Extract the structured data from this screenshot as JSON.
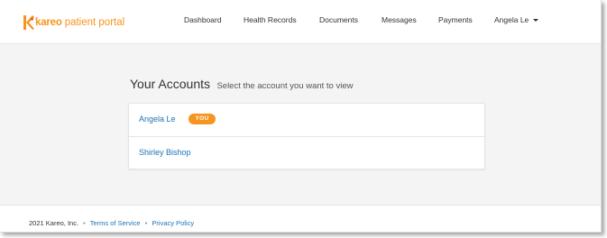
{
  "header": {
    "logo": {
      "brand": "kareo",
      "suffix": "patient portal",
      "brand_color": "#f7941d"
    },
    "nav": [
      "Dashboard",
      "Health Records",
      "Documents",
      "Messages",
      "Payments"
    ],
    "user_menu": {
      "label": "Angela Le",
      "icon": "caret-down-icon"
    }
  },
  "main": {
    "title": "Your Accounts",
    "subtitle": "Select the account you want to view",
    "accounts": [
      {
        "name": "Angela Le",
        "badge": "YOU"
      },
      {
        "name": "Shirley Bishop"
      }
    ]
  },
  "footer": {
    "copyright": "2021 Kareo, Inc.",
    "separator": "•",
    "links": [
      "Terms of Service",
      "Privacy Policy"
    ]
  },
  "colors": {
    "accent": "#f7941d",
    "link": "#1c74b8",
    "background": "#f4f4f4"
  }
}
